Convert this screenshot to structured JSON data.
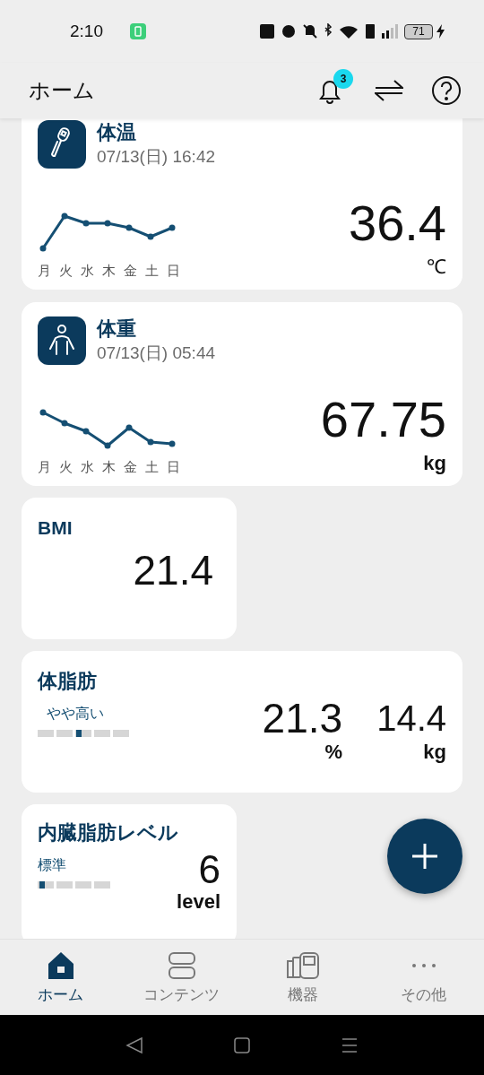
{
  "status_bar": {
    "time": "2:10",
    "battery": "71"
  },
  "header": {
    "title": "ホーム",
    "notification_count": "3"
  },
  "trend_cards": [
    {
      "kind": "temperature",
      "title": "体温",
      "date": "07/13(日) 16:42",
      "value": "36.4",
      "unit": "℃",
      "days": [
        "月",
        "火",
        "水",
        "木",
        "金",
        "土",
        "日"
      ]
    },
    {
      "kind": "weight",
      "title": "体重",
      "date": "07/13(日) 05:44",
      "value": "67.75",
      "unit": "kg",
      "days": [
        "月",
        "火",
        "水",
        "木",
        "金",
        "土",
        "日"
      ]
    }
  ],
  "bmi_card": {
    "title": "BMI",
    "value": "21.4"
  },
  "body_fat_card": {
    "title": "体脂肪",
    "status": "やや高い",
    "level": 0.45,
    "percent": "21.3",
    "percent_unit": "%",
    "mass": "14.4",
    "mass_unit": "kg"
  },
  "visceral_card": {
    "title": "内臓脂肪レベル",
    "status": "標準",
    "level": 0.03,
    "value": "6",
    "unit": "level"
  },
  "bottom_nav": [
    {
      "kind": "home",
      "label": "ホーム",
      "selected": true
    },
    {
      "kind": "contents",
      "label": "コンテンツ",
      "selected": false
    },
    {
      "kind": "devices",
      "label": "機器",
      "selected": false
    },
    {
      "kind": "more",
      "label": "その他",
      "selected": false
    }
  ]
}
